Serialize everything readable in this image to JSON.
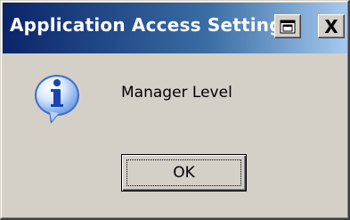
{
  "window": {
    "title": "Application Access Settings",
    "accent_color": "#0a246a",
    "background_color": "#d4d0c8"
  },
  "titlebar": {
    "restore_icon": "restore-icon",
    "close_label": "X"
  },
  "dialog": {
    "icon": "information-icon",
    "message": "Manager Level",
    "ok_label": "OK"
  }
}
